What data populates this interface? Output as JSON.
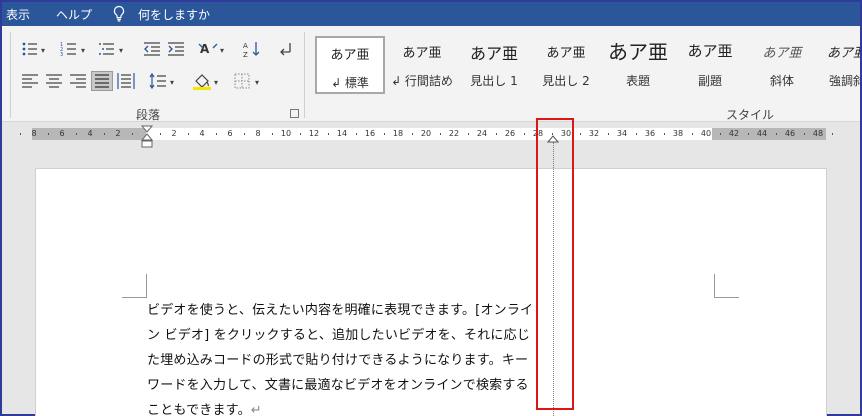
{
  "menu": {
    "items": [
      "表示",
      "ヘルプ",
      "何をしますか"
    ],
    "tell_me_icon": "lightbulb-icon"
  },
  "paragraph_group": {
    "label": "段落",
    "icons": [
      "bullets-icon",
      "numbering-icon",
      "multilevel-list-icon",
      "decrease-indent-icon",
      "increase-indent-icon",
      "text-direction-icon",
      "sort-icon",
      "paragraph-mark-icon",
      "align-left-icon",
      "align-center-icon",
      "align-right-icon",
      "justify-icon",
      "distributed-icon",
      "line-spacing-icon",
      "shading-icon",
      "borders-icon",
      "dialog-launcher-icon"
    ],
    "active_alignment": "justify"
  },
  "styles_group": {
    "label": "スタイル",
    "items": [
      {
        "sample": "あア亜",
        "name": "↲ 標準",
        "selected": true
      },
      {
        "sample": "あア亜",
        "name": "↲ 行間詰め",
        "selected": false
      },
      {
        "sample": "あア亜",
        "name": "見出し 1",
        "selected": false
      },
      {
        "sample": "あア亜",
        "name": "見出し 2",
        "selected": false
      },
      {
        "sample": "あア亜",
        "name": "表題",
        "selected": false
      },
      {
        "sample": "あア亜",
        "name": "副題",
        "selected": false
      },
      {
        "sample": "あア亜",
        "name": "斜体",
        "selected": false
      },
      {
        "sample": "あア亜",
        "name": "強調斜",
        "selected": false
      }
    ]
  },
  "ruler": {
    "left_labels": [
      "8",
      "6",
      "4",
      "2"
    ],
    "main_labels": [
      "2",
      "4",
      "6",
      "8",
      "10",
      "12",
      "14",
      "16",
      "18",
      "20",
      "22",
      "24",
      "26",
      "28",
      "30",
      "32",
      "34",
      "36",
      "38",
      "40",
      "42",
      "44",
      "46",
      "48"
    ]
  },
  "document": {
    "lines": [
      "ビデオを使うと、伝えたい内容を明確に表現できます。[オンライ",
      "ン ビデオ] をクリックすると、追加したいビデオを、それに応じ",
      "た埋め込みコードの形式で貼り付けできるようになります。キー",
      "ワードを入力して、文書に最適なビデオをオンラインで検索する",
      "こともできます。"
    ],
    "end_mark": "↵"
  },
  "colors": {
    "titlebar": "#2b579a",
    "ribbon": "#f3f3f3",
    "highlight": "#e01515",
    "canvas": "#e6e6e6"
  }
}
